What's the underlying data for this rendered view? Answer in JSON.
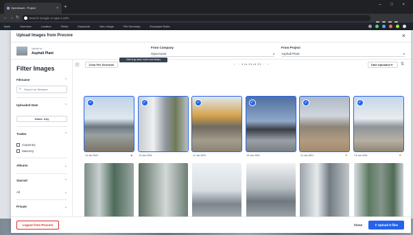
{
  "browser": {
    "tab_title": "OpenAsset - Project",
    "url_placeholder": "Search Google or type a URL",
    "tab_close": "×",
    "new_tab": "+",
    "window_controls": "– □ ×"
  },
  "app_nav": {
    "items": [
      "Back",
      "Overview",
      "Location",
      "Fields",
      "Keywords",
      "Hero Image",
      "File Summary",
      "Employee Roles"
    ]
  },
  "modal": {
    "title": "Upload Images from Procore",
    "close": "×",
    "upload_to_label": "Upload to:",
    "upload_to_value": "Asphalt Plant",
    "from_company_label": "From Company",
    "from_company_value": "OpenAsset",
    "from_project_label": "From Project",
    "from_project_value": "Asphalt Plant",
    "chevron": "▾"
  },
  "filters": {
    "title": "Filter Images",
    "filename_label": "Filename",
    "search_placeholder": "Search for filename",
    "uploaded_date_label": "Uploaded Date",
    "date_value": "Dates: Any",
    "trades_label": "Trades",
    "trades": [
      "Carpentry",
      "Masonry"
    ],
    "albums_label": "Albums",
    "starred_label": "Starred",
    "starred_value": "All",
    "private_label": "Private"
  },
  "toolbar": {
    "collapse": "‹",
    "clear_label": "Clear File Selection",
    "pager_first": "«",
    "pager_prev": "‹",
    "pager_text": "1 to 21 of 21",
    "pager_next": "›",
    "pager_last": "»",
    "sort_label": "Date Uploaded",
    "sort_icon": "⇅"
  },
  "tooltip": "Click to go back, hold to see history",
  "images": [
    {
      "date": "14 Jun 2021",
      "selected": true,
      "flag": "lock"
    },
    {
      "date": "14 Jun 2021",
      "selected": true,
      "flag": ""
    },
    {
      "date": "14 Jun 2021",
      "selected": true,
      "flag": ""
    },
    {
      "date": "14 Jun 2021",
      "selected": true,
      "flag": ""
    },
    {
      "date": "14 Jun 2021",
      "selected": true,
      "flag": "star"
    },
    {
      "date": "14 Jun 2021",
      "selected": true,
      "flag": "star"
    },
    {
      "date": "",
      "selected": false,
      "flag": ""
    },
    {
      "date": "",
      "selected": false,
      "flag": ""
    },
    {
      "date": "",
      "selected": false,
      "flag": ""
    },
    {
      "date": "",
      "selected": false,
      "flag": ""
    },
    {
      "date": "",
      "selected": false,
      "flag": ""
    },
    {
      "date": "",
      "selected": false,
      "flag": ""
    }
  ],
  "footer": {
    "logout_label": "Logout from Procore",
    "close_label": "Close",
    "upload_label": "Upload 6 files",
    "upload_icon": "⇪"
  },
  "colors": {
    "accent": "#2563eb",
    "danger": "#dc2626",
    "star": "#f59e0b",
    "lock": "#ea580c"
  },
  "icons": {
    "check": "✓",
    "star": "★",
    "lock": "🔒",
    "search": "⌕"
  }
}
